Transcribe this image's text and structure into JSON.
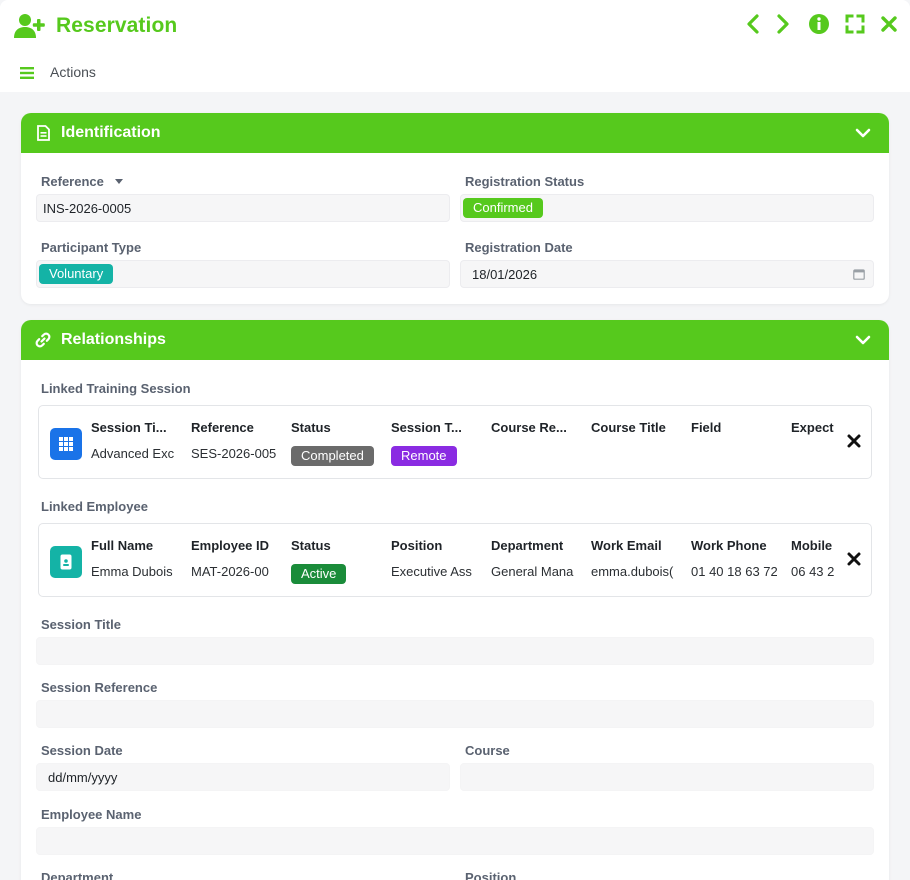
{
  "app": {
    "title": "Reservation"
  },
  "toolbar": {
    "actions_label": "Actions"
  },
  "identification": {
    "title": "Identification",
    "reference": {
      "label": "Reference",
      "value": "INS-2026-0005"
    },
    "registration_status": {
      "label": "Registration Status",
      "value": "Confirmed",
      "color": "#56c91d"
    },
    "participant_type": {
      "label": "Participant Type",
      "value": "Voluntary",
      "color": "#14b3a6"
    },
    "registration_date": {
      "label": "Registration Date",
      "value": "18/01/2026"
    }
  },
  "relationships": {
    "title": "Relationships",
    "session_label": "Linked Training Session",
    "session": {
      "columns": [
        {
          "header": "Session Ti...",
          "value": "Advanced Exc"
        },
        {
          "header": "Reference",
          "value": "SES-2026-005"
        },
        {
          "header": "Status",
          "badge": "Completed",
          "color": "#6b6b6b"
        },
        {
          "header": "Session T...",
          "badge": "Remote",
          "color": "#8a2be2"
        },
        {
          "header": "Course Re...",
          "value": ""
        },
        {
          "header": "Course Title",
          "value": ""
        },
        {
          "header": "Field",
          "value": ""
        },
        {
          "header": "Expect",
          "value": ""
        }
      ]
    },
    "employee_label": "Linked Employee",
    "employee": {
      "columns": [
        {
          "header": "Full Name",
          "value": "Emma Dubois"
        },
        {
          "header": "Employee ID",
          "value": "MAT-2026-00"
        },
        {
          "header": "Status",
          "badge": "Active",
          "color": "#1a8c3a"
        },
        {
          "header": "Position",
          "value": "Executive Ass"
        },
        {
          "header": "Department",
          "value": "General Mana"
        },
        {
          "header": "Work Email",
          "value": "emma.dubois("
        },
        {
          "header": "Work Phone",
          "value": "01 40 18 63 72"
        },
        {
          "header": "Mobile",
          "value": "06 43 2"
        }
      ]
    },
    "session_title": {
      "label": "Session Title",
      "value": ""
    },
    "session_reference": {
      "label": "Session Reference",
      "value": ""
    },
    "session_date": {
      "label": "Session Date",
      "placeholder": "dd/mm/yyyy"
    },
    "course": {
      "label": "Course",
      "value": ""
    },
    "employee_name": {
      "label": "Employee Name",
      "value": ""
    },
    "department": {
      "label": "Department"
    },
    "position": {
      "label": "Position"
    }
  },
  "icons": {
    "title": "user-plus-icon",
    "prev": "chevron-left-icon",
    "next": "chevron-right-icon",
    "info": "info-icon",
    "expand": "expand-icon",
    "close": "close-icon",
    "menu": "menu-icon"
  },
  "colors": {
    "accent": "#56c91d",
    "session_icon": "#1a73e8",
    "employee_icon": "#14b3a6"
  }
}
